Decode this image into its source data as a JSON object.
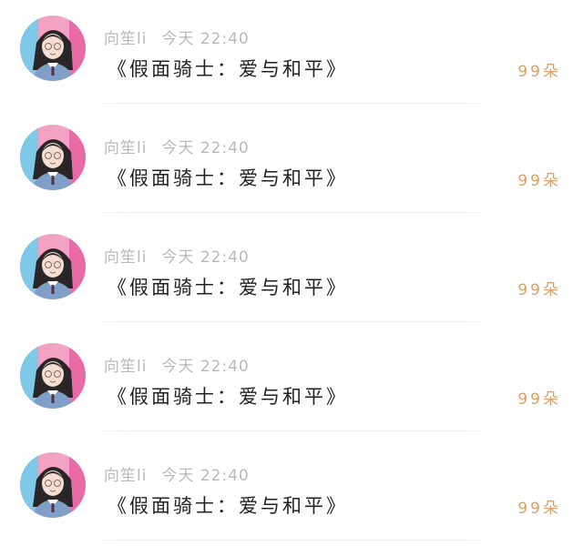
{
  "colors": {
    "name_text": "#b9b9b9",
    "title_text": "#222222",
    "count_text": "#d9a06a",
    "divider": "#ececec"
  },
  "messages": [
    {
      "name": "向笙li",
      "time": "今天 22:40",
      "title": "《假面骑士：爱与和平》",
      "count": "99朵",
      "avatar_icon": "user-avatar-icon"
    },
    {
      "name": "向笙li",
      "time": "今天 22:40",
      "title": "《假面骑士：爱与和平》",
      "count": "99朵",
      "avatar_icon": "user-avatar-icon"
    },
    {
      "name": "向笙li",
      "time": "今天 22:40",
      "title": "《假面骑士：爱与和平》",
      "count": "99朵",
      "avatar_icon": "user-avatar-icon"
    },
    {
      "name": "向笙li",
      "time": "今天 22:40",
      "title": "《假面骑士：爱与和平》",
      "count": "99朵",
      "avatar_icon": "user-avatar-icon"
    },
    {
      "name": "向笙li",
      "time": "今天 22:40",
      "title": "《假面骑士：爱与和平》",
      "count": "99朵",
      "avatar_icon": "user-avatar-icon"
    }
  ]
}
